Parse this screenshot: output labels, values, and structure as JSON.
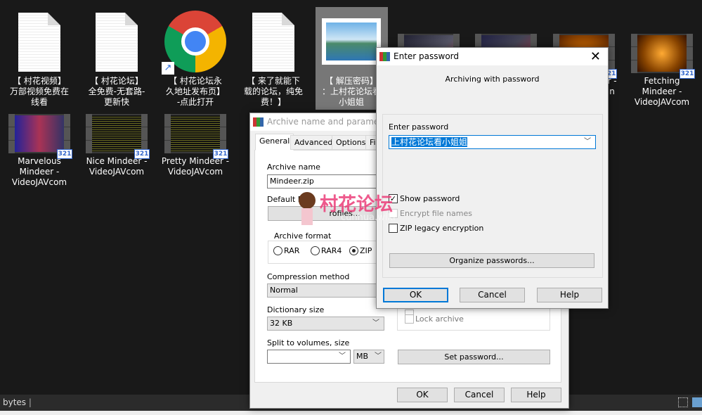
{
  "desktop": {
    "row1": [
      {
        "label": "【 村花视频】\n万部视频免费在\n线看",
        "icon": "text-file-icon"
      },
      {
        "label": "【 村花论坛】\n全免费-无套路-\n更新快",
        "icon": "text-file-icon"
      },
      {
        "label": "【 村花论坛永\n久地址发布页】\n-点此打开",
        "icon": "chrome-shortcut-icon"
      },
      {
        "label": "【 来了就能下\n载的论坛，纯免\n费！】",
        "icon": "text-file-icon"
      },
      {
        "label": "【 解压密码】\n：上村花论坛看\n小姐姐",
        "icon": "image-file-icon"
      },
      {
        "label": "",
        "icon": "video-file-icon"
      },
      {
        "label": "",
        "icon": "video-file-icon"
      },
      {
        "label": "r -\nn",
        "icon": "video-file-icon"
      },
      {
        "label": "Fetching\nMindeer -\nVideoJAVcom",
        "icon": "video-file-icon"
      }
    ],
    "row2": [
      {
        "label": "Marvelous\nMindeer -\nVideoJAVcom"
      },
      {
        "label": "Nice Mindeer -\nVideoJAVcom"
      },
      {
        "label": "Pretty Mindeer -\nVideoJAVcom"
      }
    ],
    "badge": "321",
    "statusbar": {
      "text": "bytes"
    }
  },
  "archive_dialog": {
    "title": "Archive name and parameters",
    "tabs": [
      "General",
      "Advanced",
      "Options",
      "Fi"
    ],
    "archive_name_label": "Archive name",
    "archive_name_value": "Mindeer.zip",
    "default_profile_label": "Default Pr",
    "profiles_button": "rofiles...",
    "archive_format_label": "Archive format",
    "formats": [
      "RAR",
      "RAR4",
      "ZIP"
    ],
    "selected_format": "ZIP",
    "compression_label": "Compression method",
    "compression_value": "Normal",
    "dictionary_label": "Dictionary size",
    "dictionary_value": "32 KB",
    "split_label": "Split to volumes, size",
    "split_value": "",
    "split_unit": "MB",
    "lock_archive": "Lock archive",
    "set_password_button": "Set password...",
    "ok": "OK",
    "cancel": "Cancel",
    "help": "Help"
  },
  "password_dialog": {
    "title": "Enter password",
    "heading": "Archiving with password",
    "enter_label": "Enter password",
    "password_value": "上村花论坛看小姐姐",
    "show_password": "Show password",
    "show_password_checked": true,
    "encrypt_names": "Encrypt file names",
    "encrypt_names_checked": false,
    "zip_legacy": "ZIP legacy encryption",
    "zip_legacy_checked": false,
    "organize_button": "Organize passwords...",
    "ok": "OK",
    "cancel": "Cancel",
    "help": "Help"
  },
  "watermark": {
    "text": "村花论坛",
    "sub": "cunhua.wiki"
  }
}
